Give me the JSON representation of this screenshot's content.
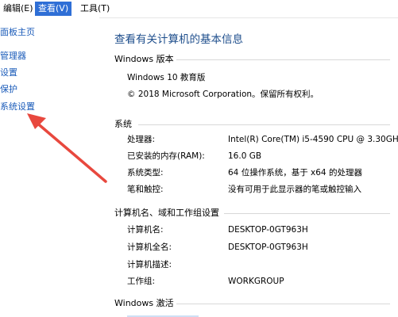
{
  "menubar": {
    "items": [
      {
        "label": "编辑(E)"
      },
      {
        "label": "查看(V)"
      },
      {
        "label": "工具(T)"
      }
    ],
    "active_color": "#2f6fd6"
  },
  "left_nav": {
    "items": [
      {
        "label": "面板主页"
      },
      {
        "label": "管理器"
      },
      {
        "label": "设置"
      },
      {
        "label": "保护"
      },
      {
        "label": "系统设置"
      }
    ],
    "link_color": "#1a5bb9"
  },
  "main": {
    "title": "查看有关计算机的基本信息",
    "title_color": "#1e4e8c",
    "windows_edition": {
      "header": "Windows 版本",
      "edition": "Windows 10 教育版",
      "copyright": "© 2018 Microsoft Corporation。保留所有权利。"
    },
    "system": {
      "header": "系统",
      "rows": [
        {
          "label": "处理器:",
          "value": "Intel(R) Core(TM) i5-4590 CPU @ 3.30GHz"
        },
        {
          "label": "已安装的内存(RAM):",
          "value": "16.0 GB"
        },
        {
          "label": "系统类型:",
          "value": "64 位操作系统，基于 x64 的处理器"
        },
        {
          "label": "笔和触控:",
          "value": "没有可用于此显示器的笔或触控输入"
        }
      ]
    },
    "computer_name": {
      "header": "计算机名、域和工作组设置",
      "rows": [
        {
          "label": "计算机名:",
          "value": "DESKTOP-0GT963H"
        },
        {
          "label": "计算机全名:",
          "value": "DESKTOP-0GT963H"
        },
        {
          "label": "计算机描述:",
          "value": ""
        },
        {
          "label": "工作组:",
          "value": "WORKGROUP"
        }
      ]
    },
    "activation": {
      "header": "Windows 激活"
    }
  },
  "annotation": {
    "arrow_color": "#e8483e"
  }
}
